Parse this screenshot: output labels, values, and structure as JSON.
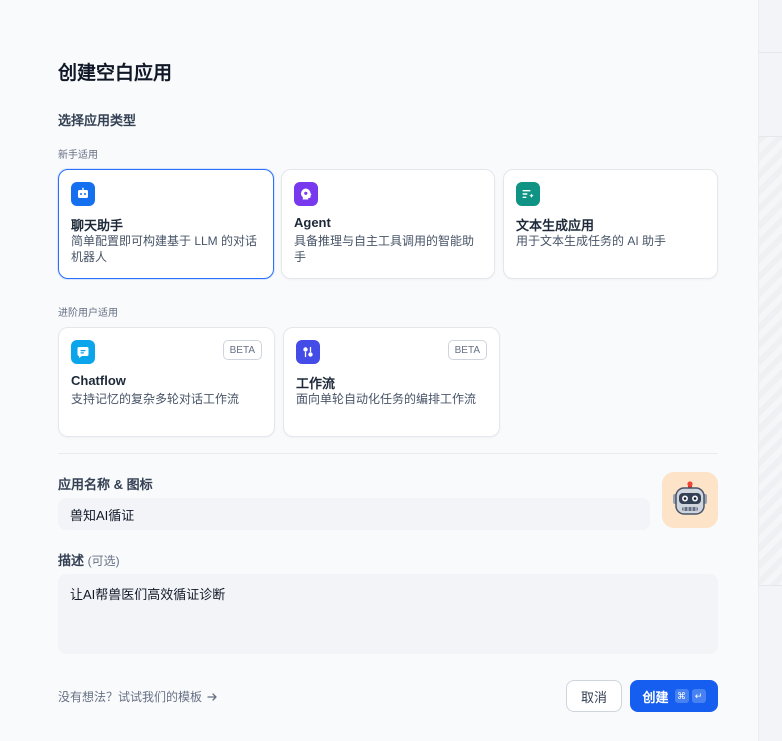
{
  "dialog": {
    "title": "创建空白应用",
    "type_section_label": "选择应用类型"
  },
  "beginner_group": {
    "label": "新手适用",
    "cards": [
      {
        "title": "聊天助手",
        "description": "简单配置即可构建基于 LLM 的对话机器人",
        "icon": "chat-bot-icon",
        "color": "#1570ef",
        "selected": true
      },
      {
        "title": "Agent",
        "description": "具备推理与自主工具调用的智能助手",
        "icon": "agent-icon",
        "color": "#7839ee",
        "selected": false
      },
      {
        "title": "文本生成应用",
        "description": "用于文本生成任务的 AI 助手",
        "icon": "text-generation-icon",
        "color": "#0e9384",
        "selected": false
      }
    ]
  },
  "advanced_group": {
    "label": "进阶用户适用",
    "cards": [
      {
        "title": "Chatflow",
        "description": "支持记忆的复杂多轮对话工作流",
        "icon": "chatflow-icon",
        "color": "#0ba5ec",
        "badge": "BETA"
      },
      {
        "title": "工作流",
        "description": "面向单轮自动化任务的编排工作流",
        "icon": "workflow-icon",
        "color": "#444ce7",
        "badge": "BETA"
      }
    ]
  },
  "name_field": {
    "label": "应用名称 & 图标",
    "value": "兽知AI循证",
    "avatar_icon": "robot-icon",
    "avatar_bg": "#fde3c8"
  },
  "description_field": {
    "label": "描述",
    "optional_hint": "(可选)",
    "value": "让AI帮兽医们高效循证诊断"
  },
  "footer": {
    "template_link": "没有想法？试试我们的模板",
    "cancel_label": "取消",
    "create_label": "创建",
    "shortcut_cmd": "⌘",
    "shortcut_enter": "↵",
    "accent_color": "#155eef"
  }
}
